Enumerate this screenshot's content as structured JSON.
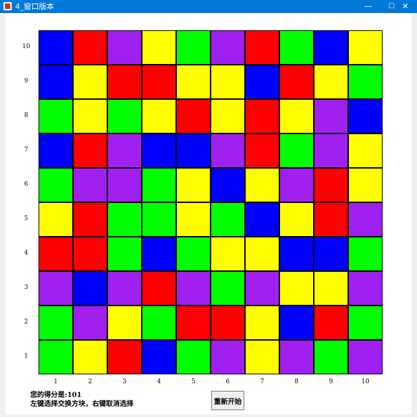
{
  "window": {
    "title": "4_窗口版本",
    "minimize_glyph": "—",
    "maximize_glyph": "☐",
    "close_glyph": "✕"
  },
  "colors": {
    "B": "#0000ff",
    "R": "#ff0000",
    "P": "#a020f0",
    "Y": "#ffff00",
    "G": "#00ff00"
  },
  "board": {
    "rows": [
      "BRPYGPRGBY",
      "BYRRYYBRYG",
      "GYGYRYRYPB",
      "BRPBBPRGPY",
      "GPPGYBYPRY",
      "YRGGYGBYRP",
      "RRGBGYYBBG",
      "PBPRPGPYYP",
      "GPYGRRYBRG",
      "GYRBGPYPGP"
    ],
    "row_labels": [
      "10",
      "9",
      "8",
      "7",
      "6",
      "5",
      "4",
      "3",
      "2",
      "1"
    ],
    "col_labels": [
      "1",
      "2",
      "3",
      "4",
      "5",
      "6",
      "7",
      "8",
      "9",
      "10"
    ]
  },
  "status": {
    "score_text": "您的得分是:101",
    "hint_text": "左键选择交换方块，右键取消选择"
  },
  "buttons": {
    "restart_label": "重新开始"
  }
}
